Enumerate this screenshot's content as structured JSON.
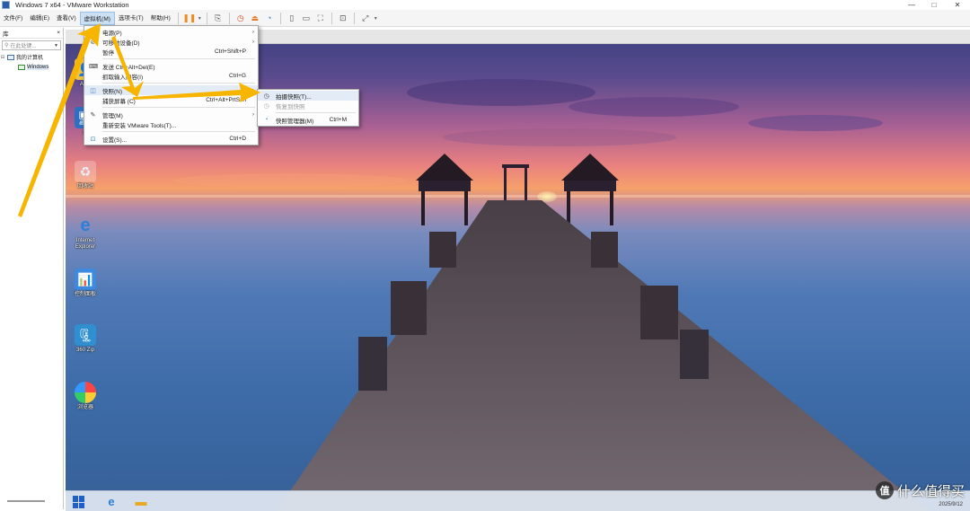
{
  "window": {
    "title": "Windows 7 x64 - VMware Workstation",
    "minimize": "—",
    "maximize": "□",
    "close": "✕"
  },
  "menubar": {
    "items": [
      {
        "label": "文件(F)"
      },
      {
        "label": "编辑(E)"
      },
      {
        "label": "查看(V)"
      },
      {
        "label": "虚拟机(M)"
      },
      {
        "label": "选项卡(T)"
      },
      {
        "label": "帮助(H)"
      }
    ]
  },
  "library": {
    "title": "库",
    "close": "×",
    "search_placeholder": "在此处键...",
    "root": "我的计算机",
    "vm": "Windows"
  },
  "vm_menu": {
    "items": [
      {
        "label": "电源(P)",
        "icon": "power-icon",
        "shortcut": "",
        "submenu": true
      },
      {
        "label": "可移动设备(D)",
        "icon": "removable-icon",
        "shortcut": "",
        "submenu": true
      },
      {
        "label": "暂停",
        "icon": "",
        "shortcut": "Ctrl+Shift+P",
        "submenu": false
      },
      {
        "label": "发送 Ctrl+Alt+Del(E)",
        "icon": "keyboard-icon",
        "shortcut": "",
        "submenu": false
      },
      {
        "label": "抓取输入内容(I)",
        "icon": "",
        "shortcut": "Ctrl+G",
        "submenu": false
      },
      {
        "label": "快照(N)",
        "icon": "snapshot-icon",
        "shortcut": "",
        "submenu": true
      },
      {
        "label": "捕获屏幕 (C)",
        "icon": "",
        "shortcut": "Ctrl+Alt+PrtScn",
        "submenu": false
      },
      {
        "label": "管理(M)",
        "icon": "wrench-icon",
        "shortcut": "",
        "submenu": true
      },
      {
        "label": "重新安装 VMware Tools(T)...",
        "icon": "",
        "shortcut": "",
        "submenu": false
      },
      {
        "label": "设置(S)...",
        "icon": "settings-icon",
        "shortcut": "Ctrl+D",
        "submenu": false
      }
    ]
  },
  "snapshot_menu": {
    "items": [
      {
        "label": "拍摄快照(T)...",
        "shortcut": "",
        "disabled": false
      },
      {
        "label": "恢复到快照",
        "shortcut": "",
        "disabled": true
      },
      {
        "label": "快照管理器(M)",
        "shortcut": "Ctrl+M",
        "disabled": false
      }
    ]
  },
  "desktop_icons": [
    {
      "label": "Adm"
    },
    {
      "label": "计"
    },
    {
      "label": "回收站"
    },
    {
      "label": "Internet\nExplorer"
    },
    {
      "label": "控制面板"
    },
    {
      "label": "360 Zip"
    },
    {
      "label": "浏览器"
    }
  ],
  "taskbar": {
    "date": "2025/9/12"
  },
  "watermark": {
    "logo": "值",
    "text": "什么值得买"
  },
  "colors": {
    "arrow": "#f7b500",
    "menu_highlight": "#e2ebf6",
    "pause": "#f08a1e"
  }
}
